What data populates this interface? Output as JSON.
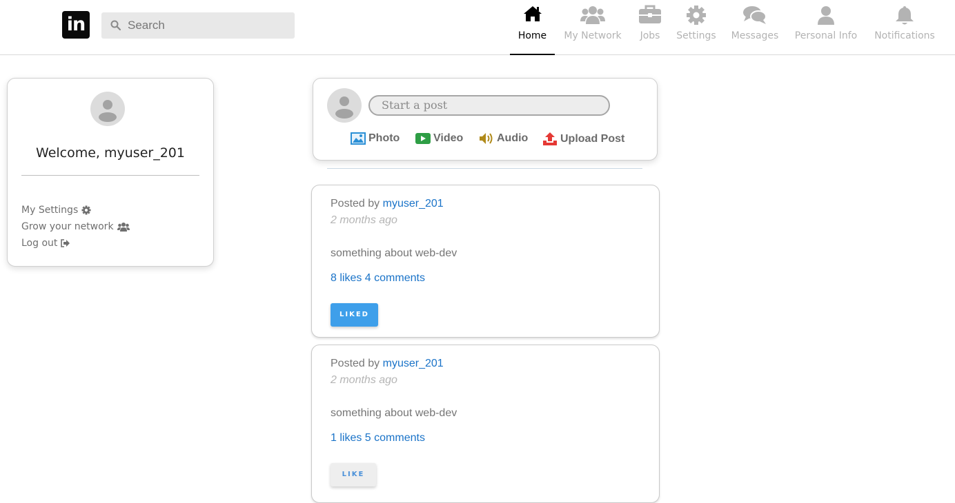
{
  "header": {
    "logo_text": "in",
    "search_placeholder": "Search",
    "nav": [
      {
        "label": "Home",
        "icon": "home-icon",
        "active": true
      },
      {
        "label": "My Network",
        "icon": "users-icon",
        "active": false
      },
      {
        "label": "Jobs",
        "icon": "briefcase-icon",
        "active": false
      },
      {
        "label": "Settings",
        "icon": "gear-icon",
        "active": false
      },
      {
        "label": "Messages",
        "icon": "chat-icon",
        "active": false
      },
      {
        "label": "Personal Info",
        "icon": "user-icon",
        "active": false
      },
      {
        "label": "Notifications",
        "icon": "bell-icon",
        "active": false
      }
    ]
  },
  "sidebar": {
    "welcome": "Welcome, myuser_201",
    "links": [
      {
        "label": "My Settings",
        "icon": "gear-icon"
      },
      {
        "label": "Grow your network",
        "icon": "users-icon"
      },
      {
        "label": "Log out",
        "icon": "sign-out-icon"
      }
    ]
  },
  "composer": {
    "placeholder": "Start a post",
    "actions": [
      {
        "label": "Photo",
        "icon": "photo-icon",
        "color": "#2a8fd6"
      },
      {
        "label": "Video",
        "icon": "video-icon",
        "color": "#2e9e45"
      },
      {
        "label": "Audio",
        "icon": "audio-icon",
        "color": "#b08a1a"
      },
      {
        "label": "Upload Post",
        "icon": "upload-icon",
        "color": "#e53935"
      }
    ]
  },
  "posts": [
    {
      "posted_by": "Posted by",
      "author": "myuser_201",
      "time": "2 months ago",
      "body": "something about web-dev",
      "stats": "8 likes 4 comments",
      "button": "LIKED"
    },
    {
      "posted_by": "Posted by",
      "author": "myuser_201",
      "time": "2 months ago",
      "body": "something about web-dev",
      "stats": "1 likes 5 comments",
      "button": "LIKE"
    }
  ],
  "colors": {
    "link": "#1a73c8",
    "liked_button": "#3e9fea",
    "nav_inactive": "#b3b3b3"
  }
}
